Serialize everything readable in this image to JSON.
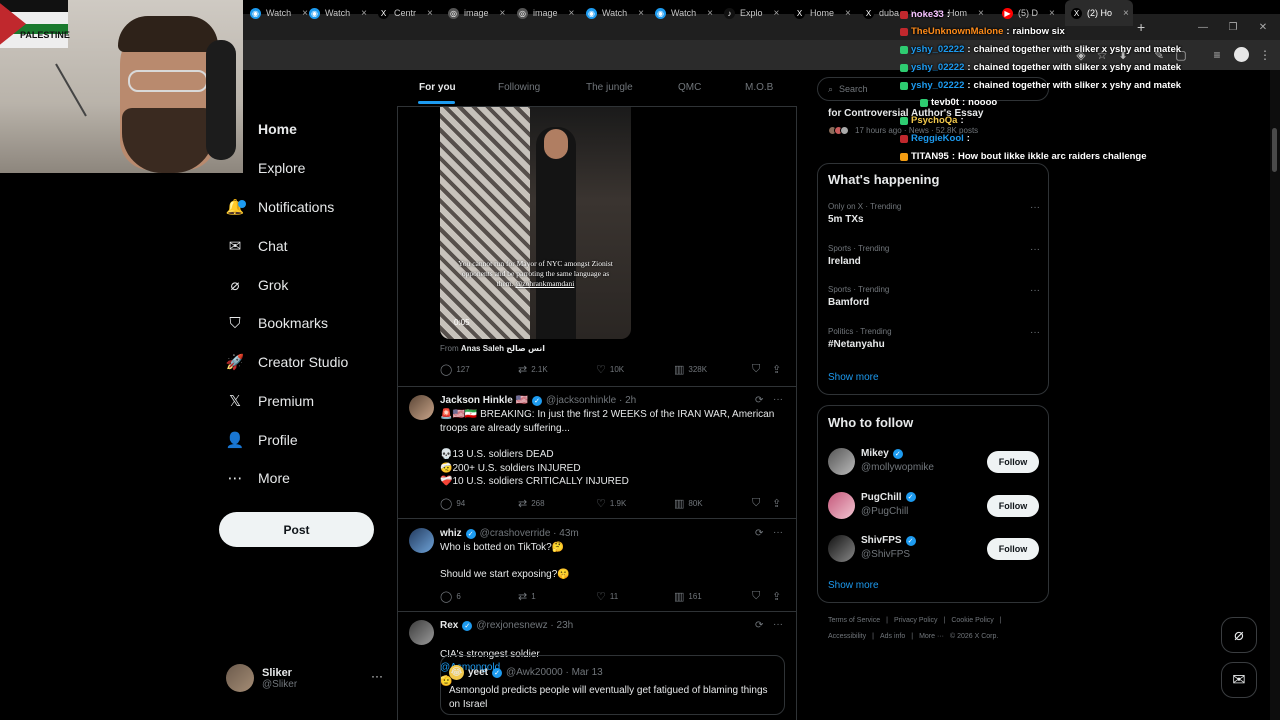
{
  "browser": {
    "tabs": [
      {
        "label": "Watch",
        "favicon_color": "#1d9bf0",
        "fav": "◉"
      },
      {
        "label": "Watch",
        "favicon_color": "#1d9bf0",
        "fav": "◉"
      },
      {
        "label": "Centr",
        "favicon_color": "#000000",
        "fav": "X"
      },
      {
        "label": "image",
        "favicon_color": "#555555",
        "fav": "◎"
      },
      {
        "label": "image",
        "favicon_color": "#555555",
        "fav": "◎"
      },
      {
        "label": "Watch",
        "favicon_color": "#1d9bf0",
        "fav": "◉"
      },
      {
        "label": "Watch",
        "favicon_color": "#1d9bf0",
        "fav": "◉"
      },
      {
        "label": "Explo",
        "favicon_color": "#111111",
        "fav": "♪"
      },
      {
        "label": "Home",
        "favicon_color": "#000000",
        "fav": "X"
      },
      {
        "label": "duba",
        "favicon_color": "#000000",
        "fav": "X"
      },
      {
        "label": "Hom",
        "favicon_color": "#000000",
        "fav": "X"
      },
      {
        "label": "(5) D",
        "favicon_color": "#ff0000",
        "fav": "▶"
      },
      {
        "label": "(2) Ho",
        "favicon_color": "#000000",
        "fav": "X"
      }
    ],
    "new_tab": "+"
  },
  "webcam": {
    "flag_text": "PALESTINE"
  },
  "nav": {
    "items": [
      {
        "label": "Home",
        "icon": "home-icon"
      },
      {
        "label": "Explore",
        "icon": "search-icon"
      },
      {
        "label": "Notifications",
        "icon": "bell-icon"
      },
      {
        "label": "Chat",
        "icon": "mail-icon"
      },
      {
        "label": "Grok",
        "icon": "grok-icon"
      },
      {
        "label": "Bookmarks",
        "icon": "bookmark-icon"
      },
      {
        "label": "Creator Studio",
        "icon": "rocket-icon"
      },
      {
        "label": "Premium",
        "icon": "x-icon"
      },
      {
        "label": "Profile",
        "icon": "person-icon"
      },
      {
        "label": "More",
        "icon": "more-circle-icon"
      }
    ],
    "post_label": "Post",
    "account": {
      "name": "Sliker",
      "handle": "@Sliker"
    }
  },
  "timeline": {
    "tabs": [
      "For you",
      "Following",
      "The jungle",
      "QMC",
      "M.O.B"
    ],
    "video_tweet": {
      "caption": "You cannot run for Mayor of NYC amongst Zionist opponents and be parroting the same language as them.",
      "caption_mention": "@zohrankmamdani",
      "time": "0:05",
      "from_label": "From",
      "from_name": "Anas Saleh انس صالح",
      "replies": "127",
      "reposts": "2.1K",
      "likes": "10K",
      "views": "328K"
    },
    "tweets": [
      {
        "name": "Jackson Hinkle 🇺🇸",
        "handle": "@jacksonhinkle · 2h",
        "line1": "🚨🇺🇸🇮🇷 BREAKING: In just the first 2 WEEKS of the IRAN WAR, American troops are already suffering...",
        "line2": "💀13 U.S. soldiers DEAD\n🤕200+ U.S. soldiers INJURED\n❤️‍🩹10 U.S. soldiers CRITICALLY INJURED",
        "replies": "94",
        "reposts": "268",
        "likes": "1.9K",
        "views": "80K"
      },
      {
        "name": "whiz",
        "handle": "@crashoverride · 43m",
        "line1": "Who is botted on TikTok?🤔",
        "line2": "Should we start exposing?🤫",
        "replies": "6",
        "reposts": "1",
        "likes": "11",
        "views": "161"
      },
      {
        "name": "Rex",
        "handle": "@rexjonesnewz · 23h",
        "text_before": "CIA's strongest soldier",
        "mention": "@Asmongold",
        "text_after": "🫡"
      }
    ],
    "quote": {
      "name": "yeet",
      "handle": "@Awk20000 · Mar 13",
      "text": "Asmongold predicts people will eventually get fatigued of blaming things on Israel"
    }
  },
  "right": {
    "search_placeholder": "Search",
    "news_title": "for Controversial Author's Essay",
    "news_meta": "17 hours ago · News · 52.8K posts",
    "happening_title": "What's happening",
    "trends": [
      {
        "meta": "Only on X · Trending",
        "topic": "5m TXs"
      },
      {
        "meta": "Sports · Trending",
        "topic": "Ireland"
      },
      {
        "meta": "Sports · Trending",
        "topic": "Bamford"
      },
      {
        "meta": "Politics · Trending",
        "topic": "#Netanyahu"
      }
    ],
    "show_more": "Show more",
    "wtf_title": "Who to follow",
    "follow_label": "Follow",
    "suggestions": [
      {
        "name": "Mikey",
        "handle": "@mollywopmike"
      },
      {
        "name": "PugChill",
        "handle": "@PugChill"
      },
      {
        "name": "ShivFPS",
        "handle": "@ShivFPS"
      }
    ],
    "footer": [
      "Terms of Service",
      "|",
      "Privacy Policy",
      "|",
      "Cookie Policy",
      "|",
      "Accessibility",
      "|",
      "Ads info",
      "|",
      "More ···",
      "© 2026 X Corp."
    ]
  },
  "chat": [
    {
      "user": "noke33",
      "msg": "",
      "color": "#f6c2ff",
      "badge": "#c0282d"
    },
    {
      "user": "TheUnknownMalone",
      "msg": "rainbow six",
      "color": "#ff8c1a",
      "badge": "#c0282d"
    },
    {
      "user": "yshy_02222",
      "msg": "chained together with sliker x yshy and matek",
      "color": "#1d9bf0",
      "badge": "#2ecc71"
    },
    {
      "user": "yshy_02222",
      "msg": "chained together with sliker x yshy and matek",
      "color": "#1d9bf0",
      "badge": "#2ecc71"
    },
    {
      "user": "yshy_02222",
      "msg": "chained together with sliker x yshy and matek",
      "color": "#1d9bf0",
      "badge": "#2ecc71"
    },
    {
      "user": "tevb0t",
      "msg": "noooo",
      "color": "#ffffff",
      "badge": "#2ecc71"
    },
    {
      "user": "PsychoQa",
      "msg": "",
      "color": "#f2c94c",
      "badge": "#2ecc71"
    },
    {
      "user": "ReggieKool",
      "msg": "",
      "color": "#1d9bf0",
      "badge": "#c0282d"
    },
    {
      "user": "TITAN95",
      "msg": "How bout likke ikkle arc raiders challenge",
      "color": "#ffffff",
      "badge": "#f39c12"
    }
  ]
}
